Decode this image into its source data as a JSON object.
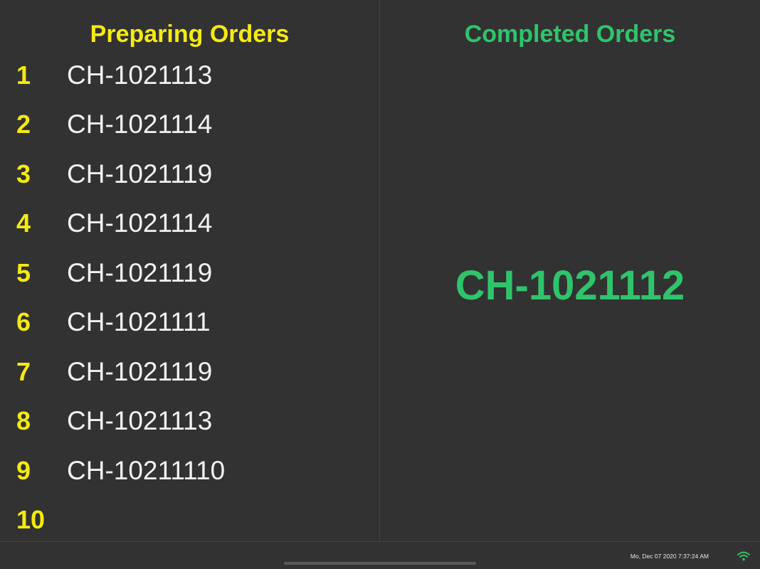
{
  "preparing": {
    "title": "Preparing Orders",
    "rows": [
      {
        "num": "1",
        "code": "CH-1021113"
      },
      {
        "num": "2",
        "code": "CH-1021114"
      },
      {
        "num": "3",
        "code": "CH-1021119"
      },
      {
        "num": "4",
        "code": "CH-1021114"
      },
      {
        "num": "5",
        "code": "CH-1021119"
      },
      {
        "num": "6",
        "code": "CH-1021111"
      },
      {
        "num": "7",
        "code": "CH-1021119"
      },
      {
        "num": "8",
        "code": "CH-1021113"
      },
      {
        "num": "9",
        "code": "CH-10211110"
      },
      {
        "num": "10",
        "code": ""
      }
    ]
  },
  "completed": {
    "title": "Completed Orders",
    "code": "CH-1021112"
  },
  "status_bar": {
    "datetime": "Mo, Dec 07 2020 7:37:24 AM",
    "wifi_icon": "wifi-icon"
  },
  "colors": {
    "background": "#323232",
    "preparing_accent": "#f4ea12",
    "completed_accent": "#2fc46b",
    "text": "#f2f2f2"
  }
}
